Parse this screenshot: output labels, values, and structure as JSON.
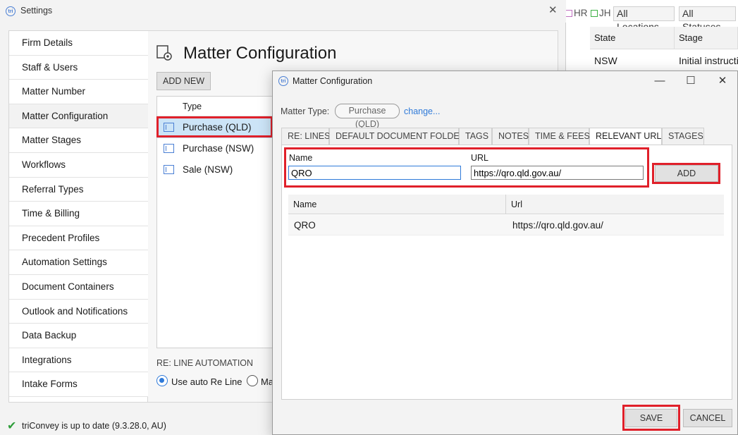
{
  "background_app": {
    "chip_hr": "HR",
    "chip_jh": "JH",
    "chip_hr_color": "#c070c0",
    "chip_jh_color": "#3cb043",
    "all_locations": "All Locations",
    "all_statuses": "All Statuses",
    "columns": [
      "State",
      "Stage"
    ],
    "row": [
      "NSW",
      "Initial instructio"
    ]
  },
  "settings": {
    "title": "Settings",
    "close_glyph": "✕",
    "nav_items": [
      "Firm Details",
      "Staff & Users",
      "Matter Number",
      "Matter Configuration",
      "Matter Stages",
      "Workflows",
      "Referral Types",
      "Time & Billing",
      "Precedent Profiles",
      "Automation Settings",
      "Document Containers",
      "Outlook and Notifications",
      "Data Backup",
      "Integrations",
      "Intake Forms"
    ],
    "active_nav_index": 3,
    "page_title": "Matter Configuration",
    "add_new_label": "ADD NEW",
    "type_header": "Type",
    "types": [
      "Purchase (QLD)",
      "Purchase (NSW)",
      "Sale (NSW)"
    ],
    "selected_type_index": 0,
    "re_line_automation_label": "RE: LINE AUTOMATION",
    "use_auto_re_line_label": "Use auto Re Line",
    "manual_option_partial": "Ma",
    "status_text": "triConvey is up to date (9.3.28.0, AU)"
  },
  "dialog": {
    "title": "Matter Configuration",
    "minimize_glyph": "—",
    "maximize_glyph": "☐",
    "close_glyph": "✕",
    "matter_type_label": "Matter Type:",
    "matter_type_value": "Purchase (QLD)",
    "change_link": "change...",
    "tabs": [
      "RE: LINES",
      "DEFAULT DOCUMENT FOLDERS",
      "TAGS",
      "NOTES",
      "TIME & FEES",
      "RELEVANT URLS",
      "STAGES"
    ],
    "active_tab_index": 5,
    "name_label": "Name",
    "url_label": "URL",
    "name_value": "QRO",
    "url_value": "https://qro.qld.gov.au/",
    "add_label": "ADD",
    "grid_columns": [
      "Name",
      "Url"
    ],
    "grid_rows": [
      {
        "name": "QRO",
        "url": "https://qro.qld.gov.au/"
      }
    ],
    "save_label": "SAVE",
    "cancel_label": "CANCEL"
  },
  "colors": {
    "highlight_red": "#e0202a",
    "selection_blue": "#cce4f7",
    "link_blue": "#2f7ad9",
    "success_green": "#2e9d3a"
  }
}
